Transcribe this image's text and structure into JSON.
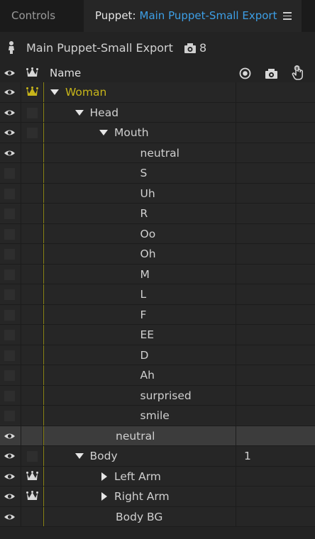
{
  "tabs": {
    "controls_label": "Controls",
    "puppet_prefix": "Puppet:",
    "puppet_name": "Main Puppet-Small Export"
  },
  "header": {
    "title": "Main Puppet-Small Export",
    "snapshot_count": "8"
  },
  "columns": {
    "name": "Name"
  },
  "colors": {
    "accent_blue": "#3d9fe6",
    "gold": "#c7b51a",
    "selected_row": "#3c3c3c"
  },
  "rows": [
    {
      "label": "Woman",
      "eye": true,
      "crown": "gold",
      "twisty": "down",
      "indent": 1,
      "gold": true,
      "value": ""
    },
    {
      "label": "Head",
      "eye": true,
      "crown": "box",
      "twisty": "down",
      "indent": 2,
      "value": ""
    },
    {
      "label": "Mouth",
      "eye": true,
      "crown": "box",
      "twisty": "down",
      "indent": 3,
      "value": ""
    },
    {
      "label": "neutral",
      "eye": true,
      "crown": "none",
      "twisty": "none",
      "indent": 4,
      "value": ""
    },
    {
      "label": "S",
      "eye": false,
      "crown": "none",
      "twisty": "none",
      "indent": 4,
      "value": ""
    },
    {
      "label": "Uh",
      "eye": false,
      "crown": "none",
      "twisty": "none",
      "indent": 4,
      "value": ""
    },
    {
      "label": "R",
      "eye": false,
      "crown": "none",
      "twisty": "none",
      "indent": 4,
      "value": ""
    },
    {
      "label": "Oo",
      "eye": false,
      "crown": "none",
      "twisty": "none",
      "indent": 4,
      "value": ""
    },
    {
      "label": "Oh",
      "eye": false,
      "crown": "none",
      "twisty": "none",
      "indent": 4,
      "value": ""
    },
    {
      "label": "M",
      "eye": false,
      "crown": "none",
      "twisty": "none",
      "indent": 4,
      "value": ""
    },
    {
      "label": "L",
      "eye": false,
      "crown": "none",
      "twisty": "none",
      "indent": 4,
      "value": ""
    },
    {
      "label": "F",
      "eye": false,
      "crown": "none",
      "twisty": "none",
      "indent": 4,
      "value": ""
    },
    {
      "label": "EE",
      "eye": false,
      "crown": "none",
      "twisty": "none",
      "indent": 4,
      "value": ""
    },
    {
      "label": "D",
      "eye": false,
      "crown": "none",
      "twisty": "none",
      "indent": 4,
      "value": ""
    },
    {
      "label": "Ah",
      "eye": false,
      "crown": "none",
      "twisty": "none",
      "indent": 4,
      "value": ""
    },
    {
      "label": "surprised",
      "eye": false,
      "crown": "none",
      "twisty": "none",
      "indent": 4,
      "value": ""
    },
    {
      "label": "smile",
      "eye": false,
      "crown": "none",
      "twisty": "none",
      "indent": 4,
      "value": ""
    },
    {
      "label": "neutral",
      "eye": true,
      "crown": "none",
      "twisty": "none",
      "indent": 3,
      "selected": true,
      "value": ""
    },
    {
      "label": "Body",
      "eye": true,
      "crown": "box",
      "twisty": "down",
      "indent": 2,
      "value": "1"
    },
    {
      "label": "Left Arm",
      "eye": true,
      "crown": "white",
      "twisty": "right",
      "indent": 3,
      "value": ""
    },
    {
      "label": "Right Arm",
      "eye": true,
      "crown": "white",
      "twisty": "right",
      "indent": 3,
      "value": ""
    },
    {
      "label": "Body BG",
      "eye": true,
      "crown": "none",
      "twisty": "none",
      "indent": 3,
      "value": ""
    }
  ]
}
